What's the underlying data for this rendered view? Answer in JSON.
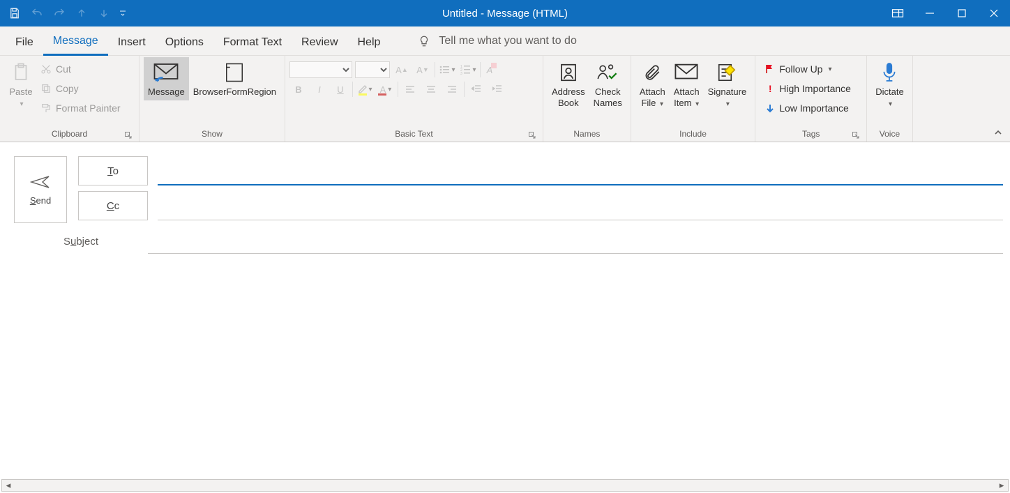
{
  "window": {
    "title": "Untitled  -  Message (HTML)"
  },
  "qat": {
    "save": "save-icon",
    "undo": "undo-icon",
    "redo": "redo-icon",
    "prev": "prev-icon",
    "next": "next-icon",
    "customize": "customize-icon"
  },
  "tabs": {
    "file": "File",
    "message": "Message",
    "insert": "Insert",
    "options": "Options",
    "format_text": "Format Text",
    "review": "Review",
    "help": "Help",
    "tellme_placeholder": "Tell me what you want to do"
  },
  "ribbon": {
    "clipboard": {
      "label": "Clipboard",
      "paste": "Paste",
      "cut": "Cut",
      "copy": "Copy",
      "format_painter": "Format Painter"
    },
    "show": {
      "label": "Show",
      "message": "Message",
      "browser_region": "BrowserFormRegion"
    },
    "basic_text": {
      "label": "Basic Text",
      "font_name": "",
      "font_size": ""
    },
    "names": {
      "label": "Names",
      "address_book": "Address\nBook",
      "check_names": "Check\nNames"
    },
    "include": {
      "label": "Include",
      "attach_file": "Attach\nFile",
      "attach_item": "Attach\nItem",
      "signature": "Signature"
    },
    "tags": {
      "label": "Tags",
      "follow_up": "Follow Up",
      "high": "High Importance",
      "low": "Low Importance"
    },
    "voice": {
      "label": "Voice",
      "dictate": "Dictate"
    }
  },
  "compose": {
    "send": "Send",
    "to": "To",
    "cc": "Cc",
    "subject": "Subject",
    "to_value": "",
    "cc_value": "",
    "subject_value": "",
    "body_value": ""
  }
}
